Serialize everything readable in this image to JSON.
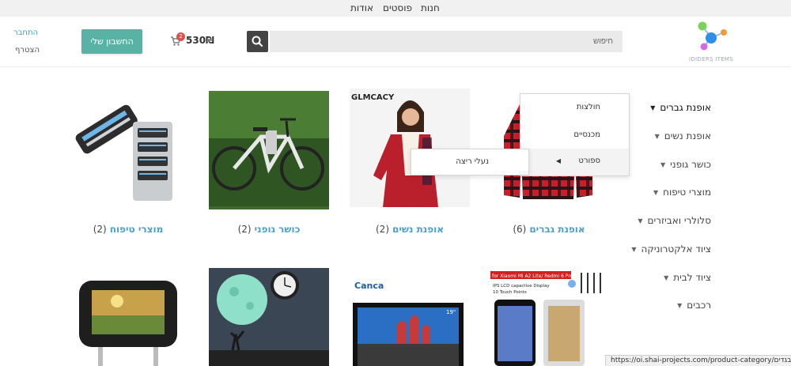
{
  "top_nav": {
    "items": [
      "חנות",
      "פוסטים",
      "אודות"
    ]
  },
  "header": {
    "logo_text": "IDIDERS ITEMS",
    "search_placeholder": "חיפוש",
    "cart_total": "530₪",
    "cart_count": "2",
    "account_button": "החשבון שלי",
    "login_link": "התחבר",
    "register_link": "הצטרף",
    "colors": {
      "accent": "#58b3a4",
      "link": "#4aa0c8",
      "badge": "#d9534f"
    }
  },
  "categories": [
    {
      "label": "אופנת גברים",
      "active": true
    },
    {
      "label": "אופנת נשים",
      "active": false
    },
    {
      "label": "כושר גופני",
      "active": false
    },
    {
      "label": "מוצרי טיפוח",
      "active": false
    },
    {
      "label": "סלולרי ואביזרים",
      "active": false
    },
    {
      "label": "ציוד אלקטרוניקה",
      "active": false
    },
    {
      "label": "ציוד לבית",
      "active": false
    },
    {
      "label": "רכבים",
      "active": false
    }
  ],
  "dropdown": {
    "items": [
      "חולצות",
      "מכנסיים",
      "ספורט"
    ],
    "hovered": "ספורט",
    "submenu": [
      "נעלי ריצה"
    ]
  },
  "products": [
    {
      "name": "אופנת גברים",
      "count": "(6)",
      "image": "red-plaid-shirt"
    },
    {
      "name": "אופנת נשים",
      "count": "(2)",
      "image": "woman-blouse",
      "image_text": "GLMCACY"
    },
    {
      "name": "כושר גופני",
      "count": "(2)",
      "image": "electric-bicycle"
    },
    {
      "name": "מוצרי טיפוח",
      "count": "(2)",
      "image": "razor-blades"
    },
    {
      "image": "phone-lcd-screen",
      "image_text": [
        "for Xiaomi Mi A2 Lite/ Redmi 6 Pro",
        "IPS LCD capactive Display",
        "10 Touch Points"
      ]
    },
    {
      "image": "tv-moscow",
      "image_text": [
        "Canca",
        "19\""
      ]
    },
    {
      "image": "moon-wall-clock"
    },
    {
      "image": "car-headrest-monitor"
    }
  ],
  "status_url": "https://oi.shai-projects.com/product-category/ספורט/בגדים"
}
